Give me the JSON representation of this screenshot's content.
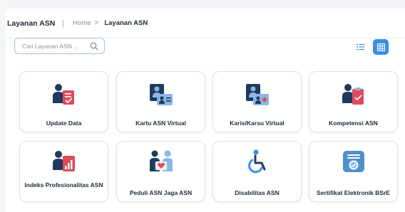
{
  "header": {
    "title": "Layanan ASN",
    "separator": "|",
    "breadcrumb": {
      "home": "Home",
      "chevron": ">",
      "current": "Layanan ASN"
    }
  },
  "search": {
    "placeholder": "Cari Layanan ASN ...",
    "value": "",
    "icon": "search-icon"
  },
  "view_toggle": {
    "list_icon": "list-view-icon",
    "grid_icon": "grid-view-icon",
    "active": "grid"
  },
  "colors": {
    "accent": "#3a8ee8",
    "icon_navy": "#1f3a5f",
    "icon_light_blue": "#8ab8e6",
    "icon_red": "#e04a5a"
  },
  "services": [
    {
      "label": "Update Data",
      "icon": "update-data-icon"
    },
    {
      "label": "Kartu ASN Virtual",
      "icon": "id-card-icon"
    },
    {
      "label": "Karis/Karsu Virtual",
      "icon": "family-card-icon"
    },
    {
      "label": "Kompetensi ASN",
      "icon": "competency-icon"
    },
    {
      "label": "Indeks Profesionalitas ASN",
      "icon": "professionalism-index-icon"
    },
    {
      "label": "Peduli ASN Jaga ASN",
      "icon": "care-icon"
    },
    {
      "label": "Disabilitas ASN",
      "icon": "wheelchair-icon"
    },
    {
      "label": "Sertifikat Elektronik BSrE",
      "icon": "certificate-icon"
    }
  ]
}
